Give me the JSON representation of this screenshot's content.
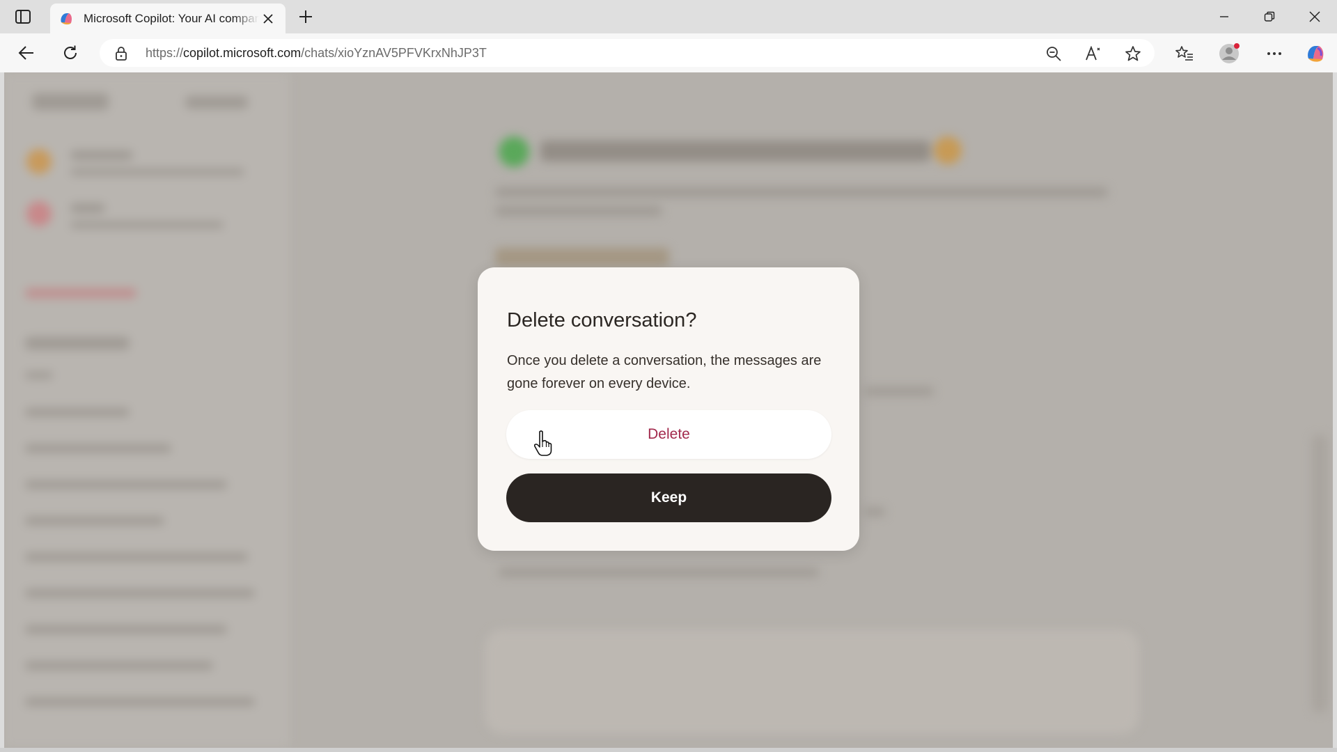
{
  "browser": {
    "tab_title": "Microsoft Copilot: Your AI companion",
    "url_domain": "copilot.microsoft.com",
    "url_prefix": "https://",
    "url_path": "/chats/xioYznAV5PFVKrxNhJP3T",
    "new_tab_symbol": "+",
    "icons": {
      "sidebar": "tab-actions-icon",
      "back": "back-arrow-icon",
      "refresh": "refresh-icon",
      "lock": "lock-icon",
      "zoom": "zoom-out-icon",
      "read_aloud": "read-aloud-icon",
      "favorite": "star-icon",
      "favorites": "favorites-list-icon",
      "profile": "profile-avatar-icon",
      "more": "more-dots-icon",
      "copilot": "copilot-icon"
    }
  },
  "dialog": {
    "title": "Delete conversation?",
    "body": "Once you delete a conversation, the messages are gone forever on every device.",
    "delete_label": "Delete",
    "keep_label": "Keep"
  },
  "colors": {
    "delete_text": "#a2294c",
    "keep_bg": "#2a2522",
    "dialog_bg": "#f9f6f3",
    "backdrop": "#b4b0ab"
  }
}
